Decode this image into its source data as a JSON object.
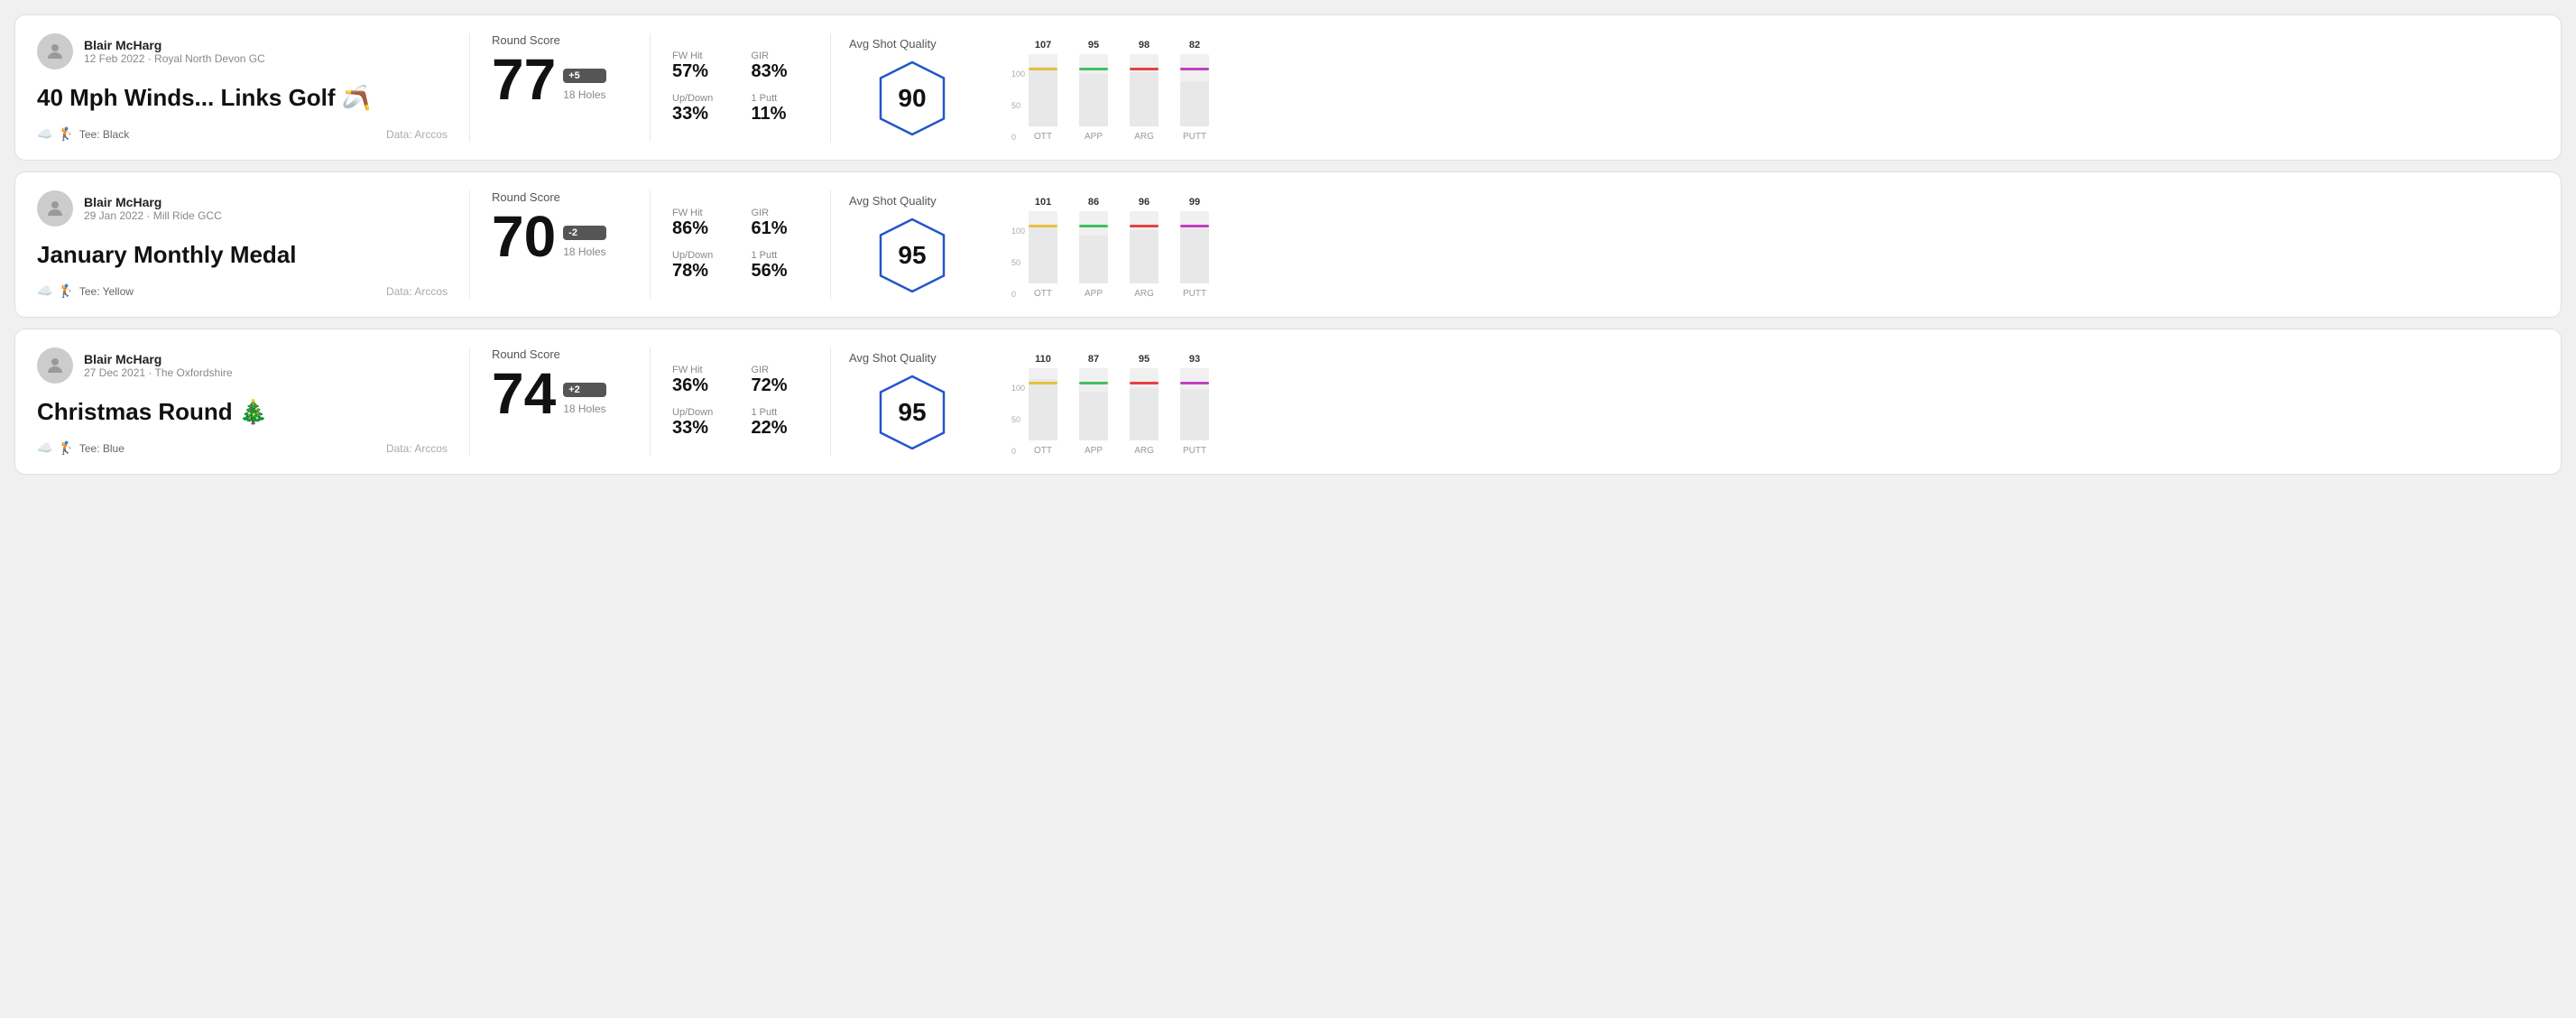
{
  "rounds": [
    {
      "id": "round1",
      "user": {
        "name": "Blair McHarg",
        "date": "12 Feb 2022",
        "course": "Royal North Devon GC"
      },
      "title": "40 Mph Winds... Links Golf 🪃",
      "tee": "Black",
      "data_source": "Data: Arccos",
      "score": {
        "label": "Round Score",
        "value": "77",
        "badge": "+5",
        "badge_sign": "positive",
        "holes": "18 Holes"
      },
      "stats": {
        "fw_hit_label": "FW Hit",
        "fw_hit_value": "57%",
        "gir_label": "GIR",
        "gir_value": "83%",
        "updown_label": "Up/Down",
        "updown_value": "33%",
        "oneputt_label": "1 Putt",
        "oneputt_value": "11%"
      },
      "quality": {
        "label": "Avg Shot Quality",
        "score": "90"
      },
      "chart": {
        "bars": [
          {
            "label": "OTT",
            "value": 107,
            "color": "#e8c040",
            "max": 130
          },
          {
            "label": "APP",
            "value": 95,
            "color": "#40c060",
            "max": 130
          },
          {
            "label": "ARG",
            "value": 98,
            "color": "#e84040",
            "max": 130
          },
          {
            "label": "PUTT",
            "value": 82,
            "color": "#c040c0",
            "max": 130
          }
        ],
        "axis_labels": [
          "100",
          "50",
          "0"
        ]
      }
    },
    {
      "id": "round2",
      "user": {
        "name": "Blair McHarg",
        "date": "29 Jan 2022",
        "course": "Mill Ride GCC"
      },
      "title": "January Monthly Medal",
      "tee": "Yellow",
      "data_source": "Data: Arccos",
      "score": {
        "label": "Round Score",
        "value": "70",
        "badge": "-2",
        "badge_sign": "negative",
        "holes": "18 Holes"
      },
      "stats": {
        "fw_hit_label": "FW Hit",
        "fw_hit_value": "86%",
        "gir_label": "GIR",
        "gir_value": "61%",
        "updown_label": "Up/Down",
        "updown_value": "78%",
        "oneputt_label": "1 Putt",
        "oneputt_value": "56%"
      },
      "quality": {
        "label": "Avg Shot Quality",
        "score": "95"
      },
      "chart": {
        "bars": [
          {
            "label": "OTT",
            "value": 101,
            "color": "#e8c040",
            "max": 130
          },
          {
            "label": "APP",
            "value": 86,
            "color": "#40c060",
            "max": 130
          },
          {
            "label": "ARG",
            "value": 96,
            "color": "#e84040",
            "max": 130
          },
          {
            "label": "PUTT",
            "value": 99,
            "color": "#c040c0",
            "max": 130
          }
        ],
        "axis_labels": [
          "100",
          "50",
          "0"
        ]
      }
    },
    {
      "id": "round3",
      "user": {
        "name": "Blair McHarg",
        "date": "27 Dec 2021",
        "course": "The Oxfordshire"
      },
      "title": "Christmas Round 🎄",
      "tee": "Blue",
      "data_source": "Data: Arccos",
      "score": {
        "label": "Round Score",
        "value": "74",
        "badge": "+2",
        "badge_sign": "positive",
        "holes": "18 Holes"
      },
      "stats": {
        "fw_hit_label": "FW Hit",
        "fw_hit_value": "36%",
        "gir_label": "GIR",
        "gir_value": "72%",
        "updown_label": "Up/Down",
        "updown_value": "33%",
        "oneputt_label": "1 Putt",
        "oneputt_value": "22%"
      },
      "quality": {
        "label": "Avg Shot Quality",
        "score": "95"
      },
      "chart": {
        "bars": [
          {
            "label": "OTT",
            "value": 110,
            "color": "#e8c040",
            "max": 130
          },
          {
            "label": "APP",
            "value": 87,
            "color": "#40c060",
            "max": 130
          },
          {
            "label": "ARG",
            "value": 95,
            "color": "#e84040",
            "max": 130
          },
          {
            "label": "PUTT",
            "value": 93,
            "color": "#c040c0",
            "max": 130
          }
        ],
        "axis_labels": [
          "100",
          "50",
          "0"
        ]
      }
    }
  ]
}
